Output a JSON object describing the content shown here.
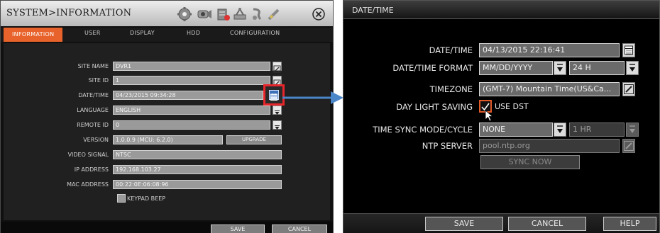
{
  "left": {
    "title": "SYSTEM>INFORMATION",
    "tabs": [
      "INFORMATION",
      "USER",
      "DISPLAY",
      "HDD",
      "CONFIGURATION"
    ],
    "fields": {
      "site_name": {
        "label": "SITE NAME",
        "value": "DVR1"
      },
      "site_id": {
        "label": "SITE ID",
        "value": "1"
      },
      "date_time": {
        "label": "DATE/TIME",
        "value": "04/23/2015 09:34:28"
      },
      "language": {
        "label": "LANGUAGE",
        "value": "ENGLISH"
      },
      "remote_id": {
        "label": "REMOTE ID",
        "value": "0"
      },
      "version": {
        "label": "VERSION",
        "value": "1.0.0.9 (MCU: 6.2.0)"
      },
      "video_signal": {
        "label": "VIDEO SIGNAL",
        "value": "NTSC"
      },
      "ip_address": {
        "label": "IP ADDRESS",
        "value": "192.168.103.27"
      },
      "mac_address": {
        "label": "MAC ADDRESS",
        "value": "00:22:0E:06:08:96"
      }
    },
    "upgrade_label": "UPGRADE",
    "keypad_beep_label": "KEYPAD BEEP",
    "save_label": "SAVE",
    "cancel_label": "CANCEL",
    "highlight_color": "#e8252a"
  },
  "right": {
    "title": "DATE/TIME",
    "date_time": {
      "label": "DATE/TIME",
      "value": "04/13/2015 22:16:41"
    },
    "format": {
      "label": "DATE/TIME FORMAT",
      "date_value": "MM/DD/YYYY",
      "time_value": "24 H"
    },
    "timezone": {
      "label": "TIMEZONE",
      "value": "(GMT-7) Mountain Time(US&Ca..."
    },
    "dst": {
      "label": "DAY LIGHT SAVING",
      "checkbox_label": "USE DST",
      "checked": true
    },
    "sync": {
      "label": "TIME SYNC MODE/CYCLE",
      "mode_value": "NONE",
      "cycle_value": "1 HR"
    },
    "ntp": {
      "label": "NTP SERVER",
      "value": "pool.ntp.org"
    },
    "sync_now_label": "SYNC NOW",
    "save_label": "SAVE",
    "cancel_label": "CANCEL",
    "help_label": "HELP"
  },
  "colors": {
    "active_tab": "#e8632b",
    "arrow": "#4a86c8"
  }
}
